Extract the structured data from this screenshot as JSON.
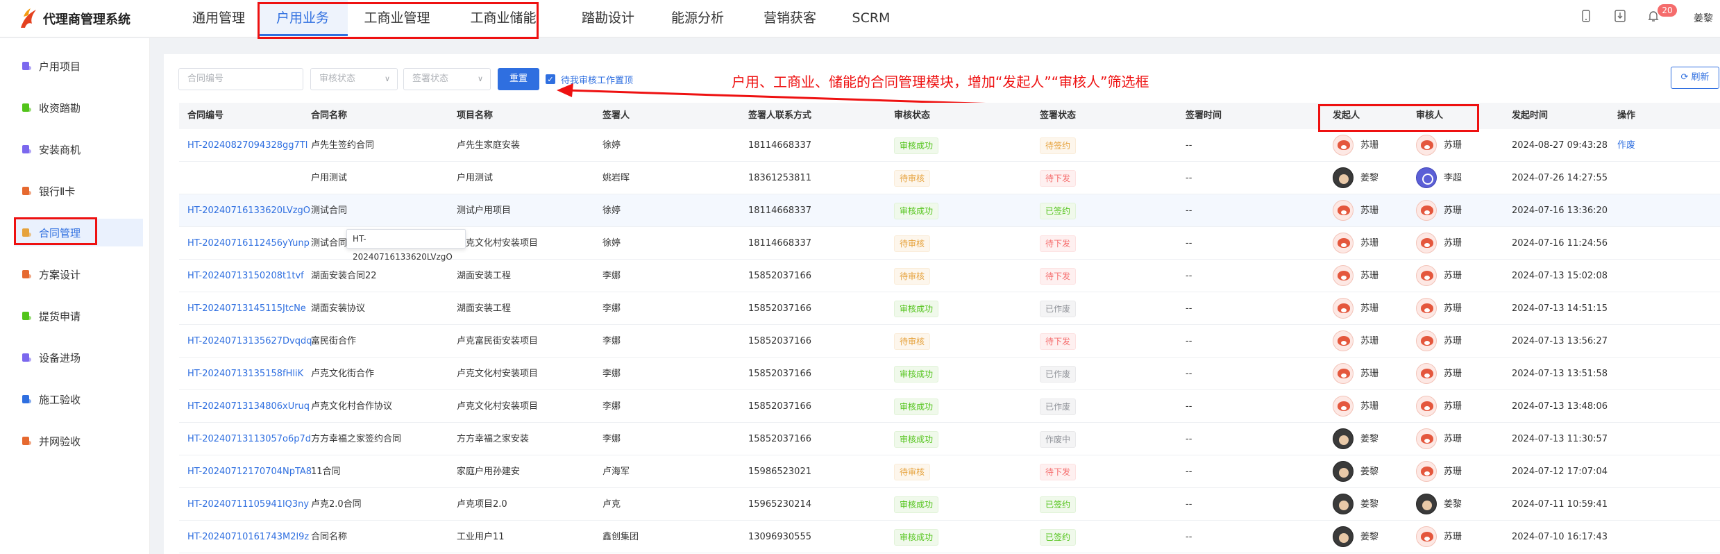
{
  "app": {
    "brand": "代理商管理系统",
    "username": "姜黎",
    "notifications": "20"
  },
  "topnav": [
    {
      "label": "通用管理",
      "active": false
    },
    {
      "label": "户用业务",
      "active": true
    },
    {
      "label": "工商业管理",
      "active": false
    },
    {
      "label": "工商业储能",
      "active": false
    },
    {
      "label": "踏勘设计",
      "active": false
    },
    {
      "label": "能源分析",
      "active": false
    },
    {
      "label": "营销获客",
      "active": false
    },
    {
      "label": "SCRM",
      "active": false
    }
  ],
  "sidebar": [
    {
      "label": "户用项目",
      "icon": "project-icon",
      "color": "#7b68ee"
    },
    {
      "label": "收资踏勘",
      "icon": "survey-icon",
      "color": "#52c41a"
    },
    {
      "label": "安装商机",
      "icon": "opportunity-icon",
      "color": "#7b68ee"
    },
    {
      "label": "银行Ⅱ卡",
      "icon": "bank-card-icon",
      "color": "#e6692f"
    },
    {
      "label": "合同管理",
      "icon": "contract-icon",
      "color": "#e6a23c",
      "active": true
    },
    {
      "label": "方案设计",
      "icon": "design-icon",
      "color": "#e6692f"
    },
    {
      "label": "提货申请",
      "icon": "pickup-icon",
      "color": "#52c41a"
    },
    {
      "label": "设备进场",
      "icon": "equipment-icon",
      "color": "#7b68ee"
    },
    {
      "label": "施工验收",
      "icon": "construction-icon",
      "color": "#2f6fe0"
    },
    {
      "label": "并网验收",
      "icon": "grid-icon",
      "color": "#e6692f"
    }
  ],
  "filters": {
    "contract_no_placeholder": "合同编号",
    "audit_status_placeholder": "审核状态",
    "sign_status_placeholder": "签署状态",
    "reset_label": "重置",
    "pending_checkbox_label": "待我审核工作置顶",
    "refresh_label": "刷新"
  },
  "annotation": "户用、工商业、储能的合同管理模块，增加“发起人”“审核人”筛选框",
  "tooltip": "HT-20240716133620LVzgO",
  "columns": [
    "合同编号",
    "合同名称",
    "项目名称",
    "签署人",
    "签署人联系方式",
    "审核状态",
    "签署状态",
    "签署时间",
    "发起人",
    "审核人",
    "发起时间",
    "操作"
  ],
  "rows": [
    {
      "no": "HT-20240827094328gg7Tl",
      "name": "卢先生签约合同",
      "project": "卢先生家庭安装",
      "signer": "徐婷",
      "phone": "18114668337",
      "audit": "审核成功",
      "audit_c": "green",
      "sign": "待签约",
      "sign_c": "orange",
      "time": "--",
      "initiator": "苏珊",
      "init_av": "fox",
      "reviewer": "苏珊",
      "rev_av": "fox",
      "start": "2024-08-27 09:43:28",
      "op": "作废"
    },
    {
      "no": "",
      "name": "户用测试",
      "project": "户用测试",
      "signer": "姚岩晖",
      "phone": "18361253811",
      "audit": "待审核",
      "audit_c": "orange",
      "sign": "待下发",
      "sign_c": "red",
      "time": "--",
      "initiator": "姜黎",
      "init_av": "dark",
      "reviewer": "李超",
      "rev_av": "blue",
      "start": "2024-07-26 14:27:55",
      "op": ""
    },
    {
      "no": "HT-20240716133620LVzgO",
      "name": "测试合同",
      "project": "测试户用项目",
      "signer": "徐婷",
      "phone": "18114668337",
      "audit": "审核成功",
      "audit_c": "green",
      "sign": "已签约",
      "sign_c": "green",
      "time": "--",
      "initiator": "苏珊",
      "init_av": "fox",
      "reviewer": "苏珊",
      "rev_av": "fox",
      "start": "2024-07-16 13:36:20",
      "op": ""
    },
    {
      "no": "HT-20240716112456yYunp",
      "name": "测试合同",
      "project": "卢克文化村安装项目",
      "signer": "徐婷",
      "phone": "18114668337",
      "audit": "待审核",
      "audit_c": "orange",
      "sign": "待下发",
      "sign_c": "red",
      "time": "--",
      "initiator": "苏珊",
      "init_av": "fox",
      "reviewer": "苏珊",
      "rev_av": "fox",
      "start": "2024-07-16 11:24:56",
      "op": ""
    },
    {
      "no": "HT-20240713150208t1tvf",
      "name": "湖面安装合同22",
      "project": "湖面安装工程",
      "signer": "李娜",
      "phone": "15852037166",
      "audit": "待审核",
      "audit_c": "orange",
      "sign": "待下发",
      "sign_c": "red",
      "time": "--",
      "initiator": "苏珊",
      "init_av": "fox",
      "reviewer": "苏珊",
      "rev_av": "fox",
      "start": "2024-07-13 15:02:08",
      "op": ""
    },
    {
      "no": "HT-20240713145115JtcNe",
      "name": "湖面安装协议",
      "project": "湖面安装工程",
      "signer": "李娜",
      "phone": "15852037166",
      "audit": "审核成功",
      "audit_c": "green",
      "sign": "已作废",
      "sign_c": "grey",
      "time": "--",
      "initiator": "苏珊",
      "init_av": "fox",
      "reviewer": "苏珊",
      "rev_av": "fox",
      "start": "2024-07-13 14:51:15",
      "op": ""
    },
    {
      "no": "HT-20240713135627Dvqdq",
      "name": "富民街合作",
      "project": "卢克富民街安装项目",
      "signer": "李娜",
      "phone": "15852037166",
      "audit": "待审核",
      "audit_c": "orange",
      "sign": "待下发",
      "sign_c": "red",
      "time": "--",
      "initiator": "苏珊",
      "init_av": "fox",
      "reviewer": "苏珊",
      "rev_av": "fox",
      "start": "2024-07-13 13:56:27",
      "op": ""
    },
    {
      "no": "HT-20240713135158fHliK",
      "name": "卢克文化街合作",
      "project": "卢克文化村安装项目",
      "signer": "李娜",
      "phone": "15852037166",
      "audit": "审核成功",
      "audit_c": "green",
      "sign": "已作废",
      "sign_c": "grey",
      "time": "--",
      "initiator": "苏珊",
      "init_av": "fox",
      "reviewer": "苏珊",
      "rev_av": "fox",
      "start": "2024-07-13 13:51:58",
      "op": ""
    },
    {
      "no": "HT-20240713134806xUruq",
      "name": "卢克文化村合作协议",
      "project": "卢克文化村安装项目",
      "signer": "李娜",
      "phone": "15852037166",
      "audit": "审核成功",
      "audit_c": "green",
      "sign": "已作废",
      "sign_c": "grey",
      "time": "--",
      "initiator": "苏珊",
      "init_av": "fox",
      "reviewer": "苏珊",
      "rev_av": "fox",
      "start": "2024-07-13 13:48:06",
      "op": ""
    },
    {
      "no": "HT-20240713113057o6p7d",
      "name": "方方幸福之家签约合同",
      "project": "方方幸福之家安装",
      "signer": "李娜",
      "phone": "15852037166",
      "audit": "审核成功",
      "audit_c": "green",
      "sign": "作废中",
      "sign_c": "grey",
      "time": "--",
      "initiator": "姜黎",
      "init_av": "dark",
      "reviewer": "苏珊",
      "rev_av": "fox",
      "start": "2024-07-13 11:30:57",
      "op": ""
    },
    {
      "no": "HT-20240712170704NpTA8",
      "name": "11合同",
      "project": "家庭户用孙建安",
      "signer": "卢海军",
      "phone": "15986523021",
      "audit": "待审核",
      "audit_c": "orange",
      "sign": "待下发",
      "sign_c": "red",
      "time": "--",
      "initiator": "姜黎",
      "init_av": "dark",
      "reviewer": "苏珊",
      "rev_av": "fox",
      "start": "2024-07-12 17:07:04",
      "op": ""
    },
    {
      "no": "HT-20240711105941lQ3ny",
      "name": "卢克2.0合同",
      "project": "卢克项目2.0",
      "signer": "卢克",
      "phone": "15965230214",
      "audit": "审核成功",
      "audit_c": "green",
      "sign": "已签约",
      "sign_c": "green",
      "time": "--",
      "initiator": "姜黎",
      "init_av": "dark",
      "reviewer": "姜黎",
      "rev_av": "dark",
      "start": "2024-07-11 10:59:41",
      "op": ""
    },
    {
      "no": "HT-20240710161743M2l9z",
      "name": "合同名称",
      "project": "工业用户11",
      "signer": "鑫创集团",
      "phone": "13096930555",
      "audit": "审核成功",
      "audit_c": "green",
      "sign": "已签约",
      "sign_c": "green",
      "time": "--",
      "initiator": "姜黎",
      "init_av": "dark",
      "reviewer": "苏珊",
      "rev_av": "fox",
      "start": "2024-07-10 16:17:43",
      "op": ""
    }
  ]
}
